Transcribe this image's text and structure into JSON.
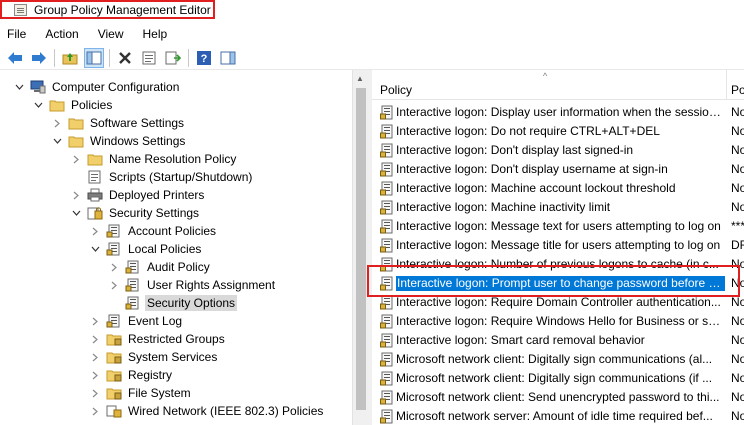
{
  "window": {
    "title": "Group Policy Management Editor"
  },
  "menu": [
    "File",
    "Action",
    "View",
    "Help"
  ],
  "toolbar": [
    "back-icon",
    "forward-icon",
    "up-folder-icon",
    "show-hide-tree-icon",
    "delete-icon",
    "properties-icon",
    "export-list-icon",
    "help-icon",
    "show-action-pane-icon"
  ],
  "tree": {
    "items": [
      {
        "label": "Computer Configuration",
        "icon": "computer-icon",
        "expanded": true
      },
      {
        "label": "Policies",
        "icon": "folder-icon",
        "expanded": true
      },
      {
        "label": "Software Settings",
        "icon": "folder-icon",
        "expanded": false
      },
      {
        "label": "Windows Settings",
        "icon": "folder-icon",
        "expanded": true
      },
      {
        "label": "Name Resolution Policy",
        "icon": "folder-icon",
        "expanded": false
      },
      {
        "label": "Scripts (Startup/Shutdown)",
        "icon": "script-icon"
      },
      {
        "label": "Deployed Printers",
        "icon": "printer-icon",
        "expanded": false
      },
      {
        "label": "Security Settings",
        "icon": "security-icon",
        "expanded": true
      },
      {
        "label": "Account Policies",
        "icon": "policy-icon",
        "expanded": false
      },
      {
        "label": "Local Policies",
        "icon": "policy-icon",
        "expanded": true
      },
      {
        "label": "Audit Policy",
        "icon": "policy-icon",
        "expanded": false
      },
      {
        "label": "User Rights Assignment",
        "icon": "policy-icon",
        "expanded": false
      },
      {
        "label": "Security Options",
        "icon": "policy-icon",
        "selected": true
      },
      {
        "label": "Event Log",
        "icon": "policy-icon",
        "expanded": false
      },
      {
        "label": "Restricted Groups",
        "icon": "lock-folder-icon",
        "expanded": false
      },
      {
        "label": "System Services",
        "icon": "lock-folder-icon",
        "expanded": false
      },
      {
        "label": "Registry",
        "icon": "lock-folder-icon",
        "expanded": false
      },
      {
        "label": "File System",
        "icon": "lock-folder-icon",
        "expanded": false
      },
      {
        "label": "Wired Network (IEEE 802.3) Policies",
        "icon": "network-icon",
        "expanded": false
      }
    ]
  },
  "list": {
    "headers": {
      "policy": "Policy",
      "setting": "Po"
    },
    "rows": [
      {
        "policy": "Interactive logon: Display user information when the session...",
        "setting": "No"
      },
      {
        "policy": "Interactive logon: Do not require CTRL+ALT+DEL",
        "setting": "No"
      },
      {
        "policy": "Interactive logon: Don't display last signed-in",
        "setting": "No"
      },
      {
        "policy": "Interactive logon: Don't display username at sign-in",
        "setting": "No"
      },
      {
        "policy": "Interactive logon: Machine account lockout threshold",
        "setting": "No"
      },
      {
        "policy": "Interactive logon: Machine inactivity limit",
        "setting": "No"
      },
      {
        "policy": "Interactive logon: Message text for users attempting to log on",
        "setting": "***"
      },
      {
        "policy": "Interactive logon: Message title for users attempting to log on",
        "setting": "DR"
      },
      {
        "policy": "Interactive logon: Number of previous logons to cache (in c...",
        "setting": "No"
      },
      {
        "policy": "Interactive logon: Prompt user to change password before e...",
        "setting": "No",
        "highlighted": true
      },
      {
        "policy": "Interactive logon: Require Domain Controller authentication...",
        "setting": "No"
      },
      {
        "policy": "Interactive logon: Require Windows Hello for Business or sm...",
        "setting": "No"
      },
      {
        "policy": "Interactive logon: Smart card removal behavior",
        "setting": "No"
      },
      {
        "policy": "Microsoft network client: Digitally sign communications (al...",
        "setting": "No"
      },
      {
        "policy": "Microsoft network client: Digitally sign communications (if ...",
        "setting": "No"
      },
      {
        "policy": "Microsoft network client: Send unencrypted password to thi...",
        "setting": "No"
      },
      {
        "policy": "Microsoft network server: Amount of idle time required bef...",
        "setting": "No"
      }
    ]
  }
}
